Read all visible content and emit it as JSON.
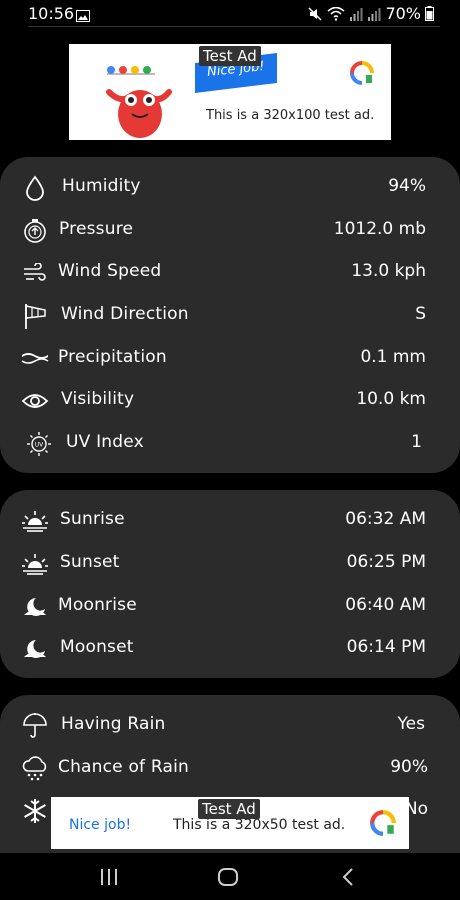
{
  "status_bar": {
    "time": "10:56",
    "battery": "70%",
    "icons": [
      "gallery-icon",
      "mute-icon",
      "wifi-icon",
      "signal-icon",
      "signal-icon",
      "battery-icon"
    ]
  },
  "ad_top": {
    "badge": "Test Ad",
    "flag_text": "Nice job!",
    "text": "This is a 320x100 test ad."
  },
  "weather_details": [
    {
      "label": "Humidity",
      "value": "94%",
      "icon": "droplet-icon"
    },
    {
      "label": "Pressure",
      "value": "1012.0 mb",
      "icon": "gauge-icon"
    },
    {
      "label": "Wind Speed",
      "value": "13.0 kph",
      "icon": "wind-icon"
    },
    {
      "label": "Wind Direction",
      "value": "S",
      "icon": "windsock-icon"
    },
    {
      "label": "Precipitation",
      "value": "0.1 mm",
      "icon": "precipitation-icon"
    },
    {
      "label": "Visibility",
      "value": "10.0 km",
      "icon": "eye-icon"
    },
    {
      "label": "UV Index",
      "value": "1",
      "icon": "uv-icon"
    }
  ],
  "astronomy": [
    {
      "label": "Sunrise",
      "value": "06:32 AM",
      "icon": "sunrise-icon"
    },
    {
      "label": "Sunset",
      "value": "06:25 PM",
      "icon": "sunset-icon"
    },
    {
      "label": "Moonrise",
      "value": "06:40 AM",
      "icon": "moonrise-icon"
    },
    {
      "label": "Moonset",
      "value": "06:14 PM",
      "icon": "moonset-icon"
    }
  ],
  "precipitation": [
    {
      "label": "Having Rain",
      "value": "Yes",
      "icon": "umbrella-icon"
    },
    {
      "label": "Chance of Rain",
      "value": "90%",
      "icon": "rain-cloud-icon"
    },
    {
      "label": "",
      "value": "No",
      "icon": "snowflake-icon"
    }
  ],
  "ad_bottom": {
    "badge": "Test Ad",
    "nice": "Nice job!",
    "text": "This is a 320x50 test ad."
  },
  "nav": [
    "recents-button",
    "home-button",
    "back-button"
  ]
}
